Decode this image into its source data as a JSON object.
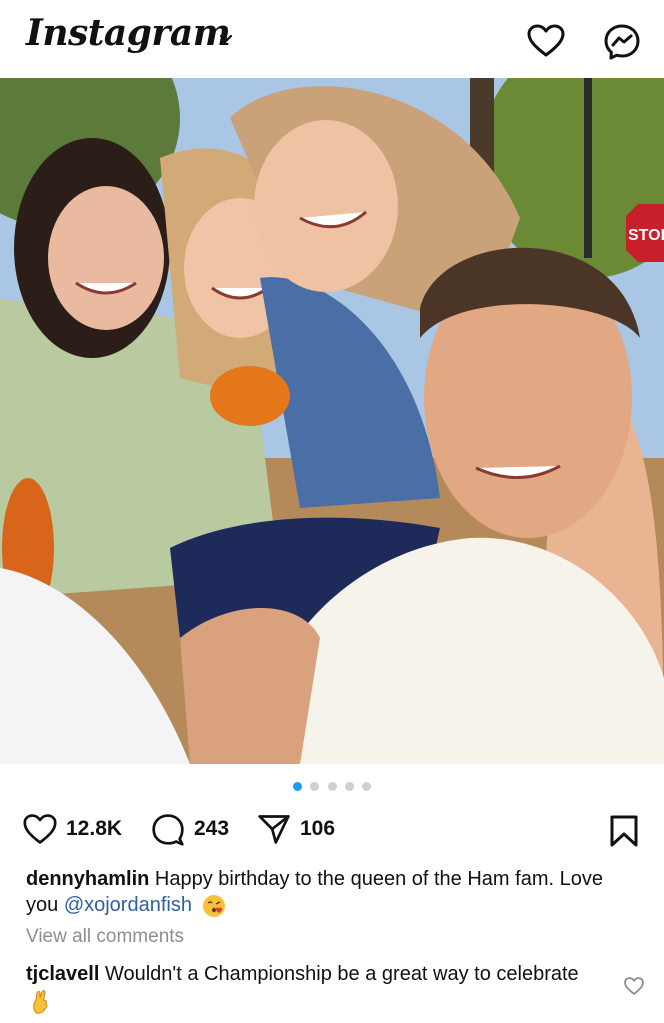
{
  "header": {
    "app_title": "Instagram",
    "icons": [
      "chevron-down-icon",
      "heart-icon",
      "messenger-icon"
    ]
  },
  "post": {
    "photo": {
      "sign_text": "STOP",
      "carousel": {
        "total": 5,
        "active_index": 0
      }
    },
    "actions": {
      "likes": "12.8K",
      "comments": "243",
      "shares": "106",
      "icons": [
        "heart-icon",
        "comment-icon",
        "share-icon",
        "bookmark-icon"
      ]
    },
    "caption": {
      "username": "dennyhamlin",
      "text": "Happy birthday to the queen of the Ham fam. Love you",
      "mention": "@xojordanfish",
      "emoji": "face-blowing-kiss"
    },
    "view_all_comments": "View all comments",
    "top_comment": {
      "username": "tjclavell",
      "text": "Wouldn't a Championship be a great way to celebrate",
      "emoji": "crossed-fingers"
    }
  },
  "colors": {
    "link": "#2f5f9f",
    "muted": "#8e8e8e",
    "carousel_active": "#1d9bf0"
  }
}
